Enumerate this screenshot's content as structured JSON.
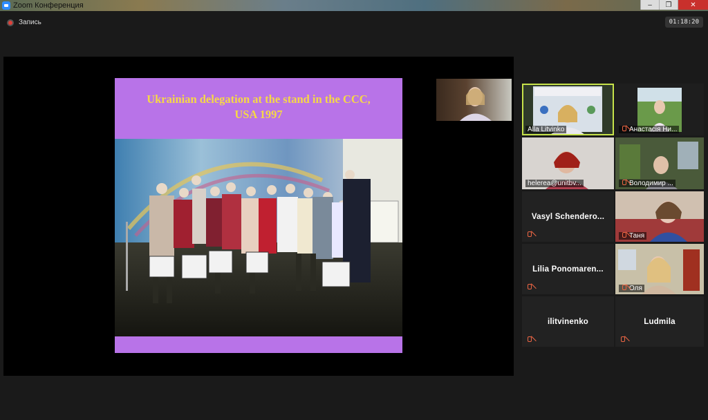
{
  "window": {
    "title": "Zoom Конференция"
  },
  "topbar": {
    "recording_label": "Запись",
    "timer": "01:18:20"
  },
  "slide": {
    "title_line1": "Ukrainian delegation at the stand in the CCC,",
    "title_line2": "USA 1997"
  },
  "participants": [
    {
      "name": "Alla Litvinko",
      "muted": false,
      "video": true
    },
    {
      "name": "Анастасія Ни...",
      "muted": true,
      "video": true
    },
    {
      "name": "helerea@unitbv...",
      "muted": false,
      "video": true
    },
    {
      "name": "Володимир ...",
      "muted": true,
      "video": true
    },
    {
      "name": "Vasyl  Schendero...",
      "muted": true,
      "video": false
    },
    {
      "name": "Таня",
      "muted": true,
      "video": true
    },
    {
      "name": "Lilia  Ponomaren...",
      "muted": true,
      "video": false
    },
    {
      "name": "Оля",
      "muted": true,
      "video": true
    },
    {
      "name": "ilitvinenko",
      "muted": true,
      "video": false
    },
    {
      "name": "Ludmila",
      "muted": true,
      "video": false
    }
  ],
  "colors": {
    "active_speaker": "#c7e34a",
    "slide_bg": "#b873e8",
    "slide_title": "#f6d846"
  }
}
